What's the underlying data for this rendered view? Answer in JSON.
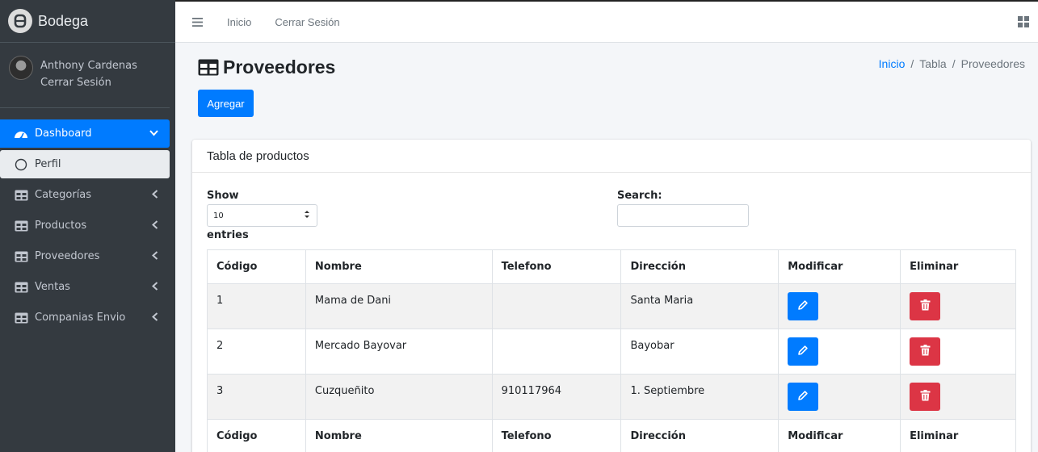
{
  "app": {
    "name": "Bodega"
  },
  "user": {
    "name": "Anthony Cardenas",
    "logout": "Cerrar Sesión"
  },
  "sidebar": {
    "items": [
      {
        "label": "Dashboard"
      },
      {
        "label": "Perfil"
      },
      {
        "label": "Categorías"
      },
      {
        "label": "Productos"
      },
      {
        "label": "Proveedores"
      },
      {
        "label": "Ventas"
      },
      {
        "label": "Companias Envio"
      }
    ]
  },
  "topbar": {
    "links": [
      "Inicio",
      "Cerrar Sesión"
    ]
  },
  "page": {
    "title": "Proveedores",
    "add_label": "Agregar"
  },
  "breadcrumb": {
    "items": [
      "Inicio",
      "Tabla",
      "Proveedores"
    ]
  },
  "card": {
    "title": "Tabla de productos"
  },
  "controls": {
    "show_label": "Show",
    "entries_value": "10",
    "entries_label": "entries",
    "search_label": "Search:"
  },
  "table": {
    "headers": [
      "Código",
      "Nombre",
      "Telefono",
      "Dirección",
      "Modificar",
      "Eliminar"
    ],
    "rows": [
      {
        "codigo": "1",
        "nombre": "Mama de Dani",
        "telefono": "",
        "direccion": "Santa Maria"
      },
      {
        "codigo": "2",
        "nombre": "Mercado Bayovar",
        "telefono": "",
        "direccion": "Bayobar"
      },
      {
        "codigo": "3",
        "nombre": "Cuzqueñito",
        "telefono": "910117964",
        "direccion": "1. Septiembre"
      }
    ]
  },
  "colors": {
    "primary": "#007bff",
    "danger": "#dc3545",
    "sidebar": "#343a40"
  }
}
